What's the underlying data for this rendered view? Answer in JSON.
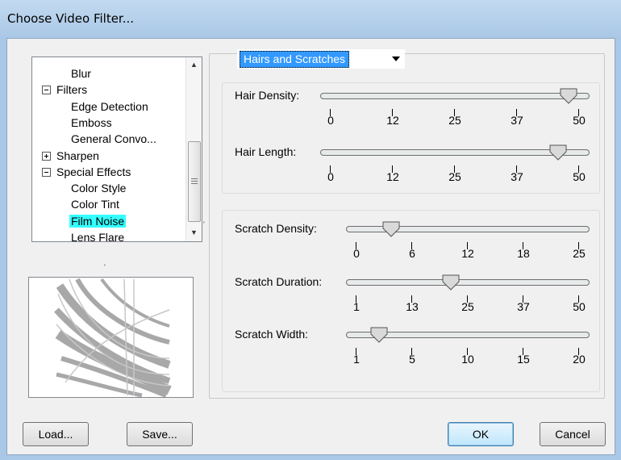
{
  "window": {
    "title": "Choose Video Filter..."
  },
  "tree": {
    "items": [
      {
        "label": "Blur",
        "indent": 2
      },
      {
        "label": "Filters",
        "indent": 1,
        "expander": "minus"
      },
      {
        "label": "Edge Detection",
        "indent": 2
      },
      {
        "label": "Emboss",
        "indent": 2
      },
      {
        "label": "General Convo...",
        "indent": 2
      },
      {
        "label": "Sharpen",
        "indent": 1,
        "expander": "plus"
      },
      {
        "label": "Special Effects",
        "indent": 1,
        "expander": "minus"
      },
      {
        "label": "Color Style",
        "indent": 2
      },
      {
        "label": "Color Tint",
        "indent": 2
      },
      {
        "label": "Film Noise",
        "indent": 2,
        "selected": true
      },
      {
        "label": "Lens Flare",
        "indent": 2
      }
    ]
  },
  "filter_dropdown": {
    "value": "Hairs and Scratches"
  },
  "sliders": {
    "hair_density": {
      "label": "Hair Density:",
      "value": 48,
      "min": 0,
      "max": 50,
      "ticks": [
        "0",
        "12",
        "25",
        "37",
        "50"
      ]
    },
    "hair_length": {
      "label": "Hair Length:",
      "value": 46,
      "min": 0,
      "max": 50,
      "ticks": [
        "0",
        "12",
        "25",
        "37",
        "50"
      ]
    },
    "scratch_density": {
      "label": "Scratch Density:",
      "value": 4,
      "min": 0,
      "max": 25,
      "ticks": [
        "0",
        "6",
        "12",
        "18",
        "25"
      ]
    },
    "scratch_duration": {
      "label": "Scratch Duration:",
      "value": 22,
      "min": 1,
      "max": 50,
      "ticks": [
        "1",
        "13",
        "25",
        "37",
        "50"
      ]
    },
    "scratch_width": {
      "label": "Scratch Width:",
      "value": 3,
      "min": 1,
      "max": 20,
      "ticks": [
        "1",
        "5",
        "10",
        "15",
        "20"
      ]
    }
  },
  "buttons": {
    "load": "Load...",
    "save": "Save...",
    "ok": "OK",
    "cancel": "Cancel"
  }
}
